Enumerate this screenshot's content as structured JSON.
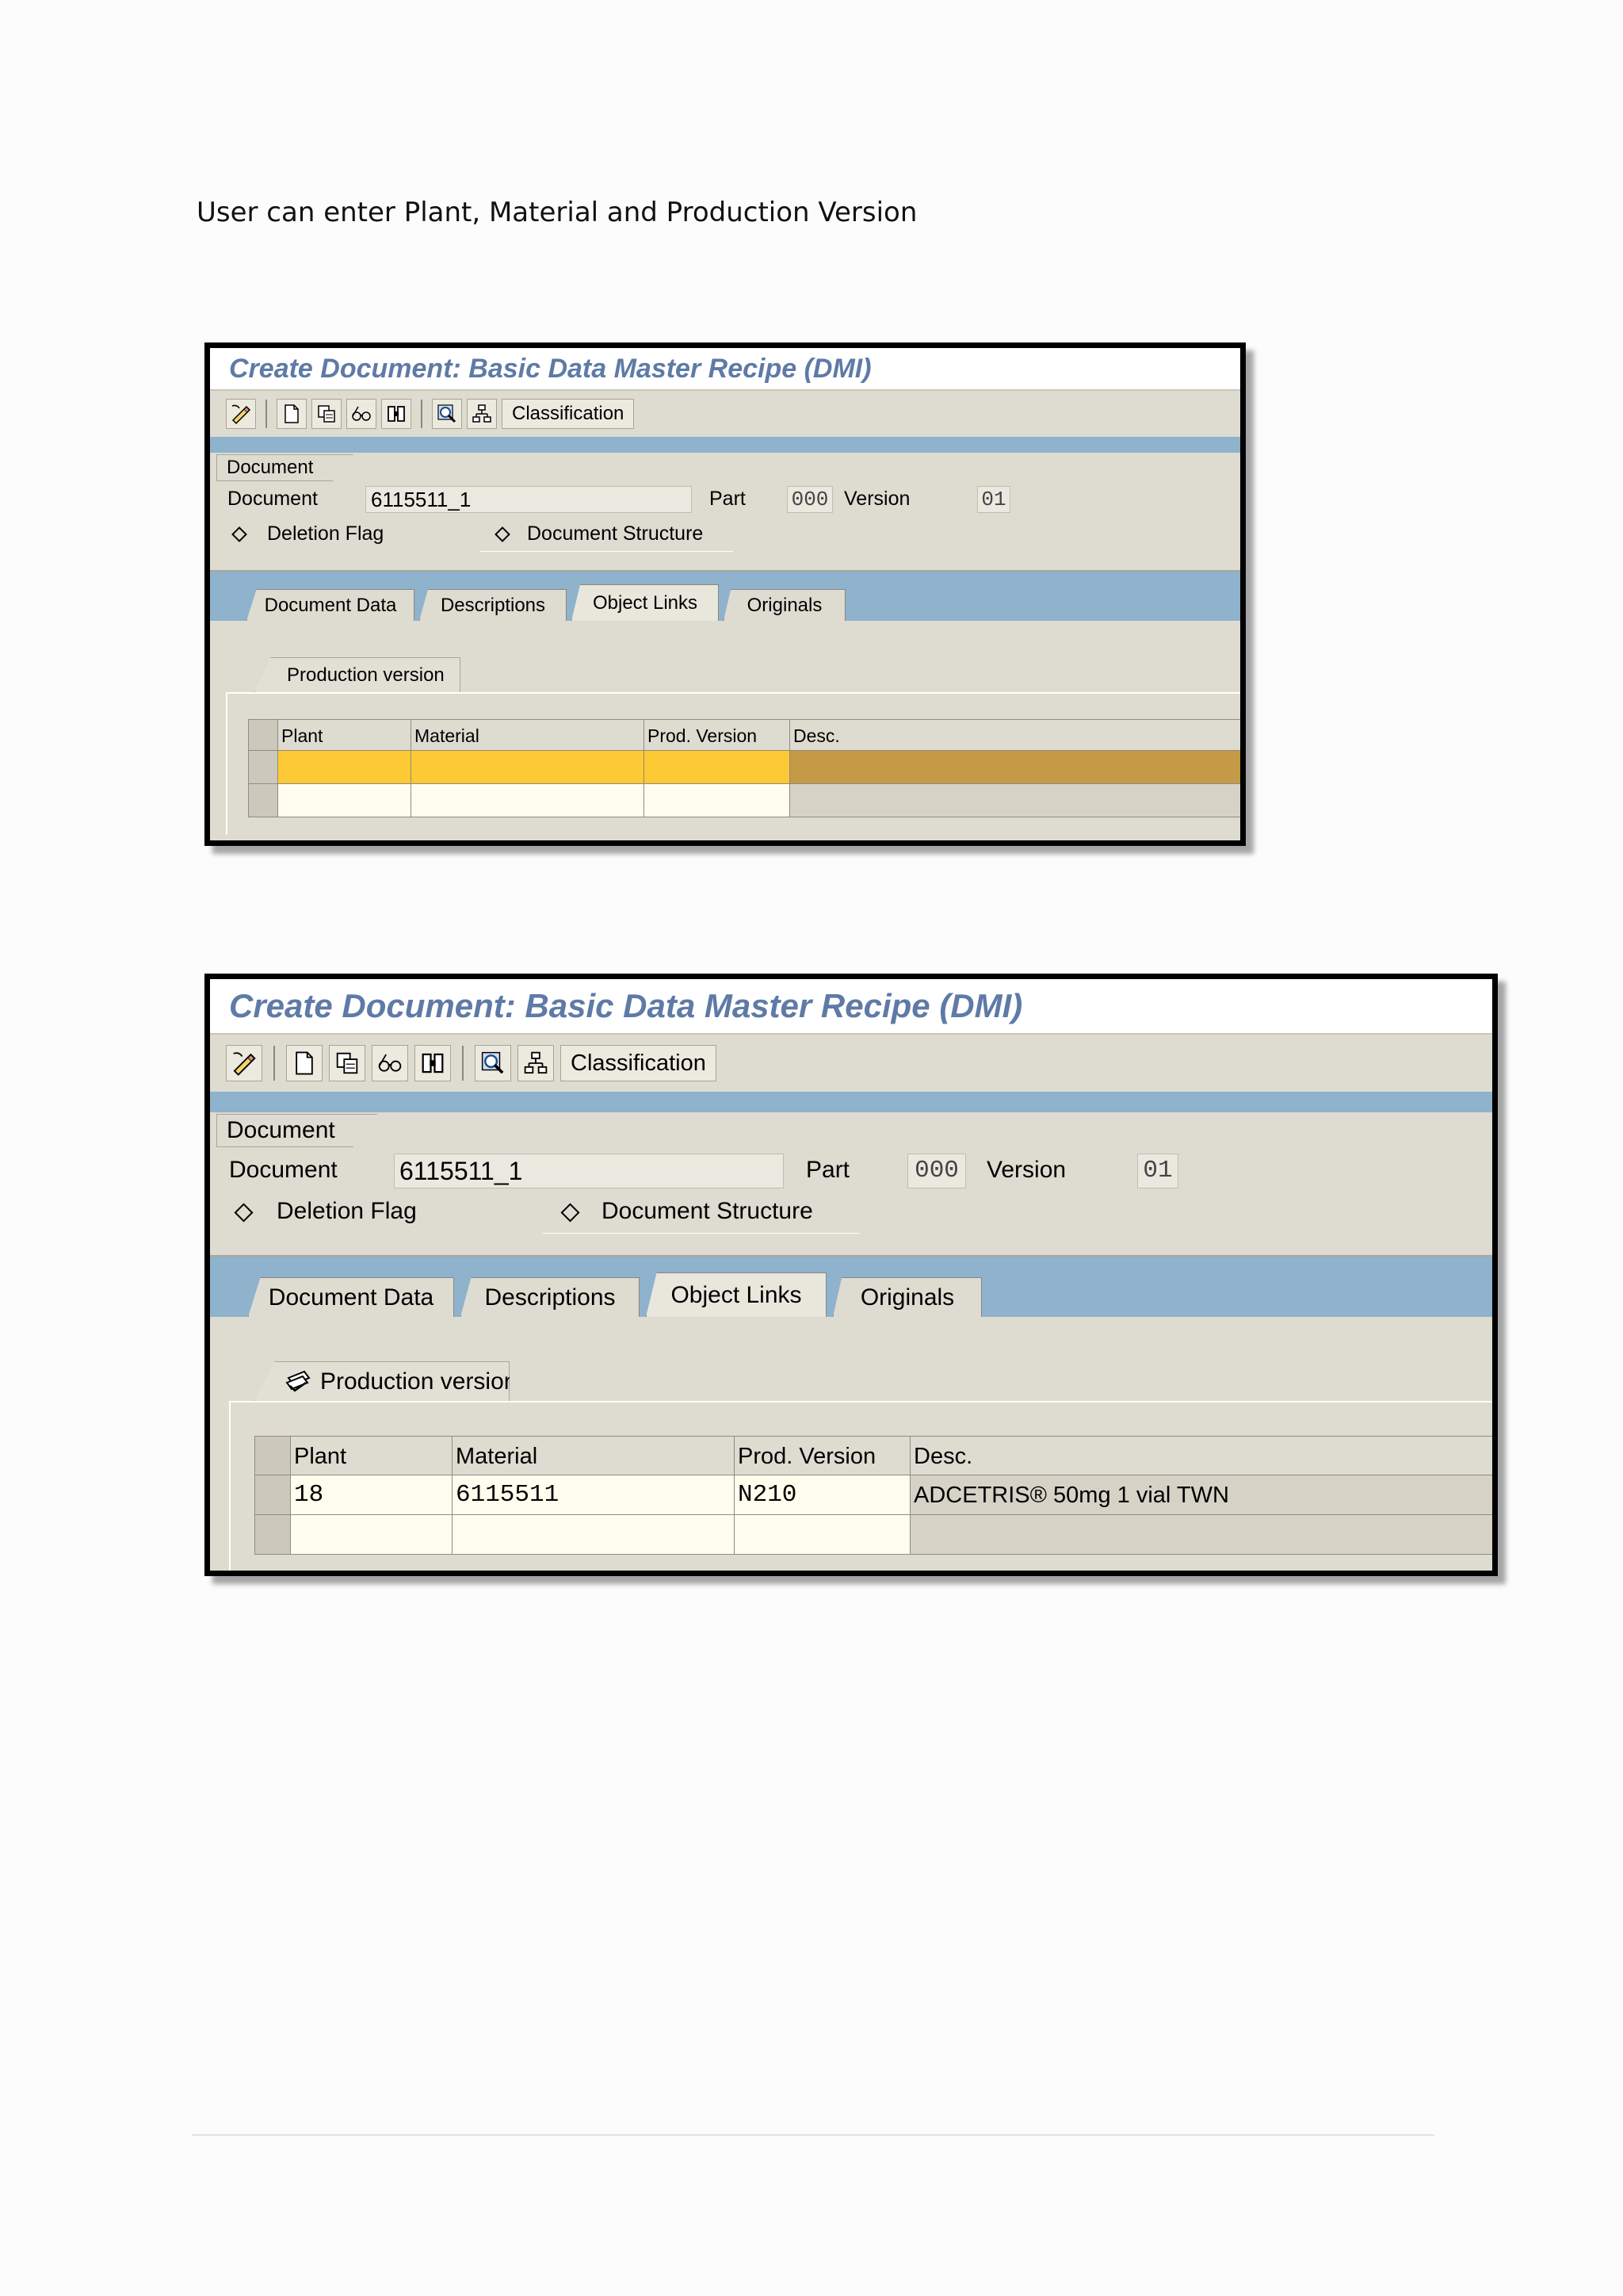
{
  "caption": "User can enter Plant, Material and Production Version",
  "screens": [
    {
      "title": "Create Document: Basic Data Master Recipe (DMI)",
      "toolbar": {
        "icons": [
          "edit-pencil-icon",
          "new-document-icon",
          "copy-document-icon",
          "glasses-display-icon",
          "binoculars-icon",
          "magnify-icon",
          "hierarchy-icon"
        ],
        "classification_label": "Classification"
      },
      "doc_group": {
        "label": "Document",
        "document_label": "Document",
        "document_value": "6115511_1",
        "part_label": "Part",
        "part_value": "000",
        "version_label": "Version",
        "version_value": "01",
        "deletion_flag_label": "Deletion Flag",
        "doc_structure_label": "Document Structure"
      },
      "tabs": [
        "Document Data",
        "Descriptions",
        "Object Links",
        "Originals"
      ],
      "active_tab": "Object Links",
      "subtab": "Production version",
      "table": {
        "columns": [
          "Plant",
          "Material",
          "Prod. Version",
          "Desc."
        ],
        "rows": [
          [
            "",
            "",
            "",
            ""
          ],
          [
            "",
            "",
            "",
            ""
          ]
        ]
      }
    },
    {
      "title": "Create Document: Basic Data Master Recipe (DMI)",
      "toolbar": {
        "icons": [
          "edit-pencil-icon",
          "new-document-icon",
          "copy-document-icon",
          "glasses-display-icon",
          "binoculars-icon",
          "magnify-icon",
          "hierarchy-icon"
        ],
        "classification_label": "Classification"
      },
      "doc_group": {
        "label": "Document",
        "document_label": "Document",
        "document_value": "6115511_1",
        "part_label": "Part",
        "part_value": "000",
        "version_label": "Version",
        "version_value": "01",
        "deletion_flag_label": "Deletion Flag",
        "doc_structure_label": "Document Structure"
      },
      "tabs": [
        "Document Data",
        "Descriptions",
        "Object Links",
        "Originals"
      ],
      "active_tab": "Object Links",
      "subtab": "Production version",
      "table": {
        "columns": [
          "Plant",
          "Material",
          "Prod. Version",
          "Desc."
        ],
        "rows": [
          [
            "18",
            "6115511",
            "N210",
            "ADCETRIS® 50mg 1 vial TWN"
          ],
          [
            "",
            "",
            "",
            ""
          ]
        ]
      }
    }
  ],
  "colors": {
    "title_text": "#5f7aa6",
    "sap_background": "#dedbd0",
    "tab_strip_blue": "#8fb2cd",
    "input_yellow": "#fdc934"
  }
}
